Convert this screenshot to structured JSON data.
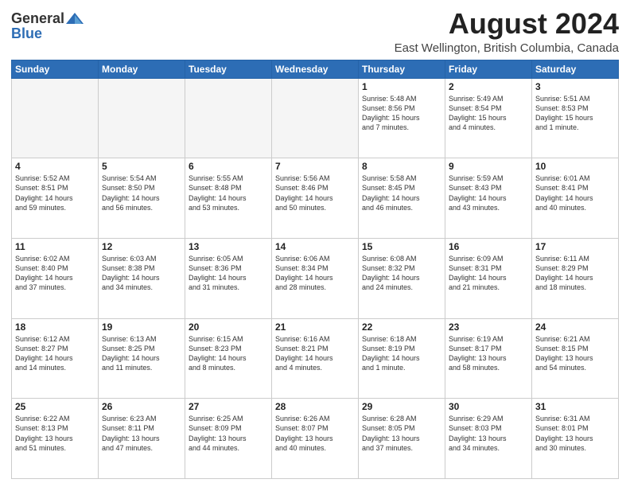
{
  "header": {
    "logo": {
      "general": "General",
      "blue": "Blue"
    },
    "title": "August 2024",
    "subtitle": "East Wellington, British Columbia, Canada"
  },
  "weekdays": [
    "Sunday",
    "Monday",
    "Tuesday",
    "Wednesday",
    "Thursday",
    "Friday",
    "Saturday"
  ],
  "weeks": [
    [
      {
        "day": "",
        "info": ""
      },
      {
        "day": "",
        "info": ""
      },
      {
        "day": "",
        "info": ""
      },
      {
        "day": "",
        "info": ""
      },
      {
        "day": "1",
        "info": "Sunrise: 5:48 AM\nSunset: 8:56 PM\nDaylight: 15 hours\nand 7 minutes."
      },
      {
        "day": "2",
        "info": "Sunrise: 5:49 AM\nSunset: 8:54 PM\nDaylight: 15 hours\nand 4 minutes."
      },
      {
        "day": "3",
        "info": "Sunrise: 5:51 AM\nSunset: 8:53 PM\nDaylight: 15 hours\nand 1 minute."
      }
    ],
    [
      {
        "day": "4",
        "info": "Sunrise: 5:52 AM\nSunset: 8:51 PM\nDaylight: 14 hours\nand 59 minutes."
      },
      {
        "day": "5",
        "info": "Sunrise: 5:54 AM\nSunset: 8:50 PM\nDaylight: 14 hours\nand 56 minutes."
      },
      {
        "day": "6",
        "info": "Sunrise: 5:55 AM\nSunset: 8:48 PM\nDaylight: 14 hours\nand 53 minutes."
      },
      {
        "day": "7",
        "info": "Sunrise: 5:56 AM\nSunset: 8:46 PM\nDaylight: 14 hours\nand 50 minutes."
      },
      {
        "day": "8",
        "info": "Sunrise: 5:58 AM\nSunset: 8:45 PM\nDaylight: 14 hours\nand 46 minutes."
      },
      {
        "day": "9",
        "info": "Sunrise: 5:59 AM\nSunset: 8:43 PM\nDaylight: 14 hours\nand 43 minutes."
      },
      {
        "day": "10",
        "info": "Sunrise: 6:01 AM\nSunset: 8:41 PM\nDaylight: 14 hours\nand 40 minutes."
      }
    ],
    [
      {
        "day": "11",
        "info": "Sunrise: 6:02 AM\nSunset: 8:40 PM\nDaylight: 14 hours\nand 37 minutes."
      },
      {
        "day": "12",
        "info": "Sunrise: 6:03 AM\nSunset: 8:38 PM\nDaylight: 14 hours\nand 34 minutes."
      },
      {
        "day": "13",
        "info": "Sunrise: 6:05 AM\nSunset: 8:36 PM\nDaylight: 14 hours\nand 31 minutes."
      },
      {
        "day": "14",
        "info": "Sunrise: 6:06 AM\nSunset: 8:34 PM\nDaylight: 14 hours\nand 28 minutes."
      },
      {
        "day": "15",
        "info": "Sunrise: 6:08 AM\nSunset: 8:32 PM\nDaylight: 14 hours\nand 24 minutes."
      },
      {
        "day": "16",
        "info": "Sunrise: 6:09 AM\nSunset: 8:31 PM\nDaylight: 14 hours\nand 21 minutes."
      },
      {
        "day": "17",
        "info": "Sunrise: 6:11 AM\nSunset: 8:29 PM\nDaylight: 14 hours\nand 18 minutes."
      }
    ],
    [
      {
        "day": "18",
        "info": "Sunrise: 6:12 AM\nSunset: 8:27 PM\nDaylight: 14 hours\nand 14 minutes."
      },
      {
        "day": "19",
        "info": "Sunrise: 6:13 AM\nSunset: 8:25 PM\nDaylight: 14 hours\nand 11 minutes."
      },
      {
        "day": "20",
        "info": "Sunrise: 6:15 AM\nSunset: 8:23 PM\nDaylight: 14 hours\nand 8 minutes."
      },
      {
        "day": "21",
        "info": "Sunrise: 6:16 AM\nSunset: 8:21 PM\nDaylight: 14 hours\nand 4 minutes."
      },
      {
        "day": "22",
        "info": "Sunrise: 6:18 AM\nSunset: 8:19 PM\nDaylight: 14 hours\nand 1 minute."
      },
      {
        "day": "23",
        "info": "Sunrise: 6:19 AM\nSunset: 8:17 PM\nDaylight: 13 hours\nand 58 minutes."
      },
      {
        "day": "24",
        "info": "Sunrise: 6:21 AM\nSunset: 8:15 PM\nDaylight: 13 hours\nand 54 minutes."
      }
    ],
    [
      {
        "day": "25",
        "info": "Sunrise: 6:22 AM\nSunset: 8:13 PM\nDaylight: 13 hours\nand 51 minutes."
      },
      {
        "day": "26",
        "info": "Sunrise: 6:23 AM\nSunset: 8:11 PM\nDaylight: 13 hours\nand 47 minutes."
      },
      {
        "day": "27",
        "info": "Sunrise: 6:25 AM\nSunset: 8:09 PM\nDaylight: 13 hours\nand 44 minutes."
      },
      {
        "day": "28",
        "info": "Sunrise: 6:26 AM\nSunset: 8:07 PM\nDaylight: 13 hours\nand 40 minutes."
      },
      {
        "day": "29",
        "info": "Sunrise: 6:28 AM\nSunset: 8:05 PM\nDaylight: 13 hours\nand 37 minutes."
      },
      {
        "day": "30",
        "info": "Sunrise: 6:29 AM\nSunset: 8:03 PM\nDaylight: 13 hours\nand 34 minutes."
      },
      {
        "day": "31",
        "info": "Sunrise: 6:31 AM\nSunset: 8:01 PM\nDaylight: 13 hours\nand 30 minutes."
      }
    ]
  ]
}
